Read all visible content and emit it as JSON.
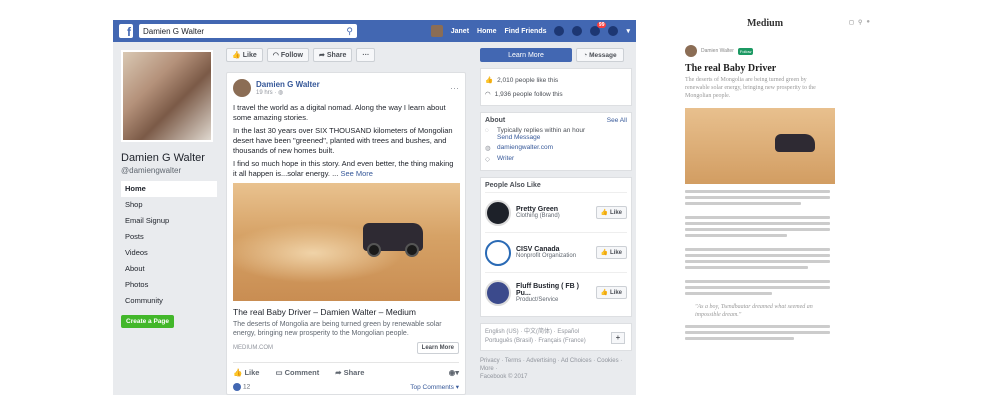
{
  "topbar": {
    "search_value": "Damien G Walter",
    "user": "Janet",
    "home": "Home",
    "find_friends": "Find Friends",
    "notif_count": "99"
  },
  "left": {
    "name": "Damien G Walter",
    "handle": "@damiengwalter",
    "nav": [
      "Home",
      "Shop",
      "Email Signup",
      "Posts",
      "Videos",
      "About",
      "Photos",
      "Community"
    ],
    "create_page": "Create a Page"
  },
  "actions": {
    "like": "Like",
    "follow": "Follow",
    "share": "Share",
    "more": "···"
  },
  "post": {
    "author": "Damien G Walter",
    "time": "19 hrs · ",
    "paragraphs": [
      "I travel the world as a digital nomad. Along the way I learn about some amazing stories.",
      "In the last 30 years over SIX THOUSAND kilometers of Mongolian desert have been \"greened\", planted with trees and bushes, and thousands of new homes built.",
      "I find so much hope in this story. And even better, the thing making it all happen is...solar energy. ..."
    ],
    "see_more": "See More",
    "link_title": "The real Baby Driver – Damien Walter – Medium",
    "link_desc": "The deserts of Mongolia are being turned green by renewable solar energy, bringing new prosperity to the Mongolian people.",
    "link_src": "MEDIUM.COM",
    "learn_more": "Learn More",
    "act_like": "Like",
    "act_comment": "Comment",
    "act_share": "Share",
    "likes": "12",
    "top_comments": "Top Comments ▾"
  },
  "right": {
    "learn_more": "Learn More",
    "message": "Message",
    "likes_count": "2,010 people like this",
    "follows_count": "1,936 people follow this",
    "about": "About",
    "see_all": "See All",
    "reply": "Typically replies within an hour",
    "send_message": "Send Message",
    "website": "damiengwalter.com",
    "writer": "Writer",
    "pal": "People Also Like",
    "pages": [
      {
        "name": "Pretty Green",
        "cat": "Clothing (Brand)",
        "btn": "Like"
      },
      {
        "name": "CISV Canada",
        "cat": "Nonprofit Organization",
        "btn": "Like"
      },
      {
        "name": "Fluff Busting ( FB ) Pu...",
        "cat": "Product/Service",
        "btn": "Like"
      }
    ],
    "langs1": "English (US) · 中文(简体) · Español",
    "langs2": "Português (Brasil) · Français (France)",
    "footer1": "Privacy · Terms · Advertising · Ad Choices · Cookies · More ·",
    "footer2": "Facebook © 2017"
  },
  "medium": {
    "brand": "Medium",
    "author_line": "Damien Walter",
    "follow": "Follow",
    "title": "The real Baby Driver",
    "subtitle": "The deserts of Mongolia are being turned green by renewable solar energy, bringing new prosperity to the Mongolian people.",
    "quote": "\"As a boy, Tsendbaatar dreamed what seemed an impossible dream.\""
  }
}
